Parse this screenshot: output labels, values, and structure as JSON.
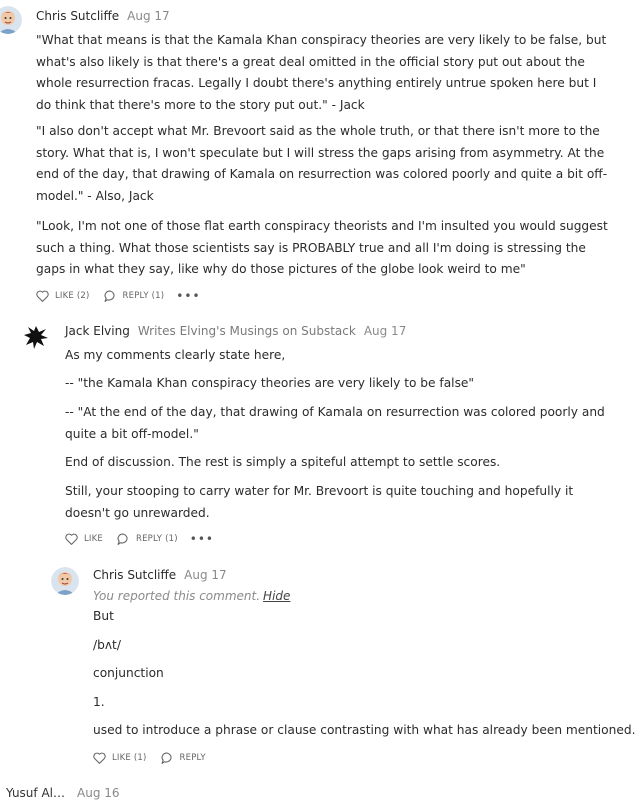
{
  "comments": [
    {
      "author": "Chris Sutcliffe",
      "date": "Aug 17",
      "paragraphs": [
        "\"What that means is that the Kamala Khan conspiracy theories are very likely to be false, but what's also likely is that there's a great deal omitted in the official story put out about the whole resurrection fracas. Legally I doubt there's anything entirely untrue spoken here but I do think that there's more to the story put out.\" - Jack",
        "\"I also don't accept what Mr. Brevoort said as the whole truth, or that there isn't more to the story. What that is, I won't speculate but I will stress the gaps arising from asymmetry. At the end of the day, that drawing of Kamala on resurrection was colored poorly and quite a bit off-model.\" - Also, Jack",
        "\"Look, I'm not one of those flat earth conspiracy theorists and I'm insulted you would suggest such a thing. What those scientists say is PROBABLY true and all I'm doing is stressing the gaps in what they say, like why do those pictures of the globe look weird to me\""
      ],
      "like_label": "LIKE (2)",
      "reply_label": "REPLY (1)",
      "more_label": "•••",
      "avatar_icon": "avatar-cartoon"
    },
    {
      "author": "Jack Elving",
      "byline": "Writes Elving's Musings on Substack",
      "date": "Aug 17",
      "paragraphs": [
        "As my comments clearly state here,",
        "-- \"the Kamala Khan conspiracy theories are very likely to be false\"",
        "-- \"At the end of the day, that drawing of Kamala on resurrection was colored poorly and quite a bit off-model.\"",
        "End of discussion. The rest is simply a spiteful attempt to settle scores.",
        "Still, your stooping to carry water for Mr. Brevoort is quite touching and hopefully it doesn't go unrewarded."
      ],
      "like_label": "LIKE",
      "reply_label": "REPLY (1)",
      "more_label": "•••",
      "avatar_icon": "avatar-ink-splatter"
    },
    {
      "author": "Chris Sutcliffe",
      "date": "Aug 17",
      "reported_text": "You reported this comment.",
      "hide_label": "Hide",
      "paragraphs": [
        "But",
        "/bʌt/",
        "conjunction",
        "1.",
        "used to introduce a phrase or clause contrasting with what has already been mentioned."
      ],
      "like_label": "LIKE (1)",
      "reply_label": "REPLY",
      "avatar_icon": "avatar-cartoon"
    }
  ],
  "next_comment": {
    "author": "Yusuf Al…",
    "date": "Aug 16"
  },
  "colors": {
    "text": "#2b2b2b",
    "muted": "#8a8a8a",
    "icon": "#666666"
  }
}
